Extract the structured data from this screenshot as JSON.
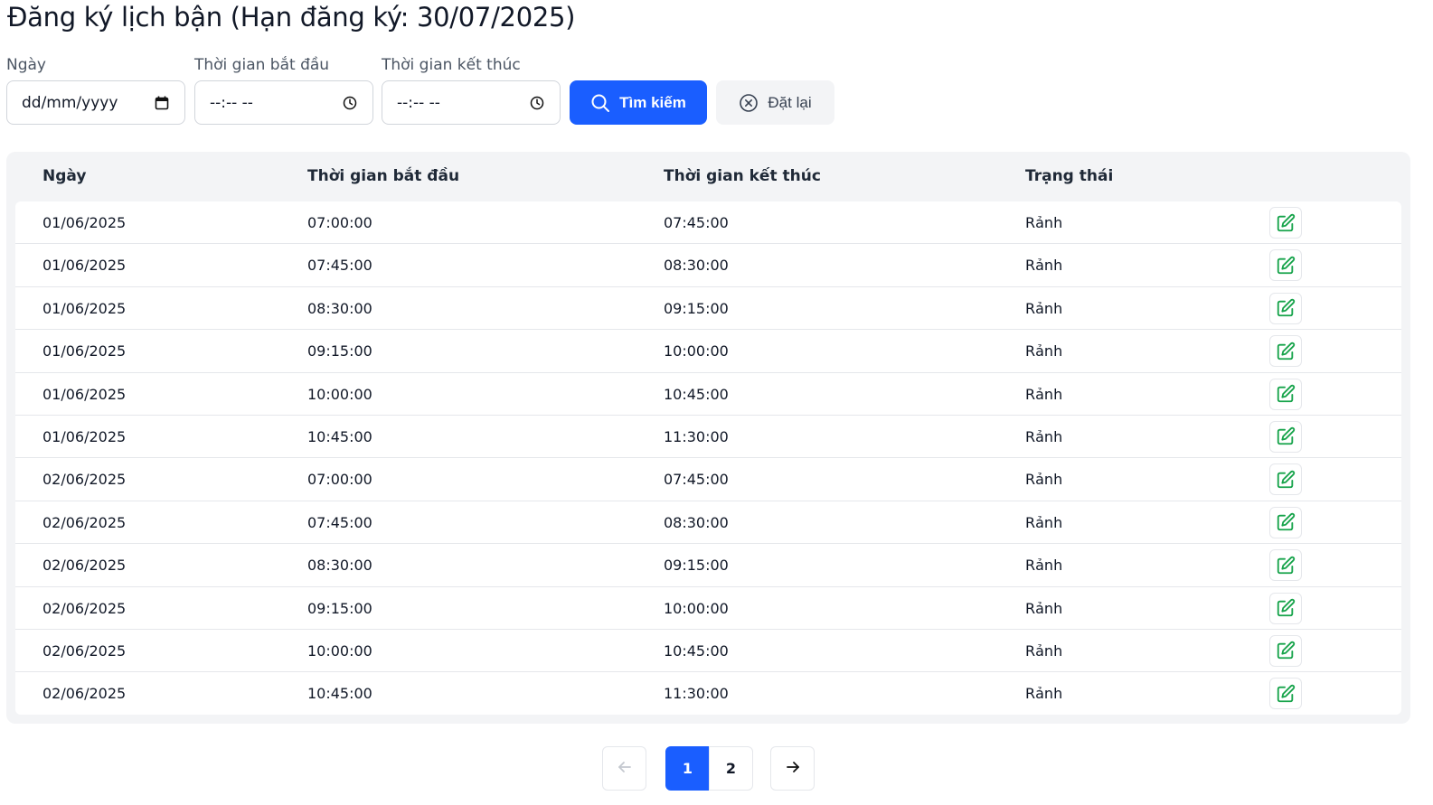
{
  "title": "Đăng ký lịch bận (Hạn đăng ký: 30/07/2025)",
  "filters": {
    "date_label": "Ngày",
    "date_value": "dd/mm/yyyy",
    "start_label": "Thời gian bắt đầu",
    "start_value": "--:-- --",
    "end_label": "Thời gian kết thúc",
    "end_value": "--:-- --",
    "search_label": "Tìm kiếm",
    "reset_label": "Đặt lại"
  },
  "table": {
    "headers": [
      "Ngày",
      "Thời gian bắt đầu",
      "Thời gian kết thúc",
      "Trạng thái"
    ],
    "rows": [
      [
        "01/06/2025",
        "07:00:00",
        "07:45:00",
        "Rảnh"
      ],
      [
        "01/06/2025",
        "07:45:00",
        "08:30:00",
        "Rảnh"
      ],
      [
        "01/06/2025",
        "08:30:00",
        "09:15:00",
        "Rảnh"
      ],
      [
        "01/06/2025",
        "09:15:00",
        "10:00:00",
        "Rảnh"
      ],
      [
        "01/06/2025",
        "10:00:00",
        "10:45:00",
        "Rảnh"
      ],
      [
        "01/06/2025",
        "10:45:00",
        "11:30:00",
        "Rảnh"
      ],
      [
        "02/06/2025",
        "07:00:00",
        "07:45:00",
        "Rảnh"
      ],
      [
        "02/06/2025",
        "07:45:00",
        "08:30:00",
        "Rảnh"
      ],
      [
        "02/06/2025",
        "08:30:00",
        "09:15:00",
        "Rảnh"
      ],
      [
        "02/06/2025",
        "09:15:00",
        "10:00:00",
        "Rảnh"
      ],
      [
        "02/06/2025",
        "10:00:00",
        "10:45:00",
        "Rảnh"
      ],
      [
        "02/06/2025",
        "10:45:00",
        "11:30:00",
        "Rảnh"
      ]
    ]
  },
  "pagination": {
    "pages": [
      "1",
      "2"
    ],
    "current": "1"
  },
  "colors": {
    "primary": "#1a5eff",
    "edit_icon": "#16a34a"
  },
  "icons": {
    "date": "calendar-icon",
    "time": "clock-icon",
    "search": "search-icon",
    "reset": "x-circle-icon",
    "edit": "edit-icon",
    "prev": "arrow-left-icon",
    "next": "arrow-right-icon"
  }
}
